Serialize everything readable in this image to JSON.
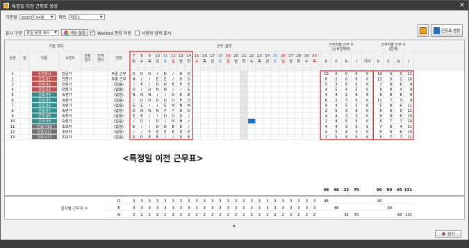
{
  "window": {
    "title": "특정일 이전 근무표 생성"
  },
  "filters": {
    "month_label": "기준월",
    "month_value": "2020년 04월",
    "part_label": "파트",
    "part_value": "파트1"
  },
  "display": {
    "label": "표시 구분",
    "value": "휴일 음영 표시",
    "color_btn": "색상 설정",
    "wanted_label": "Wanted 편집 허용",
    "user_input_label": "사용자 입력 표시"
  },
  "right_buttons": {
    "excel": "excel",
    "gen": "근무표 생성"
  },
  "headers": {
    "basic": "기본 정보",
    "shift": "근무 설정",
    "per_shift": "근무자별 근무 수",
    "per_shift_sub": "(공휴일제외)",
    "per_shift_total": "근무자별 근무 수",
    "per_shift_total_sub": "(합계)",
    "seq": "순번",
    "team": "팀",
    "name": "이름",
    "skill": "숙련도",
    "prev": "전월\n잔여",
    "carry": "잔여\n연차",
    "pattern": "전장",
    "etc": "기타"
  },
  "shift_cols": [
    "D",
    "E",
    "N",
    "/"
  ],
  "days": [
    {
      "d": "7",
      "w": "화"
    },
    {
      "d": "8",
      "w": "수"
    },
    {
      "d": "9",
      "w": "목"
    },
    {
      "d": "10",
      "w": "금"
    },
    {
      "d": "11",
      "w": "토"
    },
    {
      "d": "12",
      "w": "일"
    },
    {
      "d": "13",
      "w": "월"
    },
    {
      "d": "14",
      "w": "화"
    },
    {
      "d": "15",
      "w": "수"
    },
    {
      "d": "16",
      "w": "목"
    },
    {
      "d": "17",
      "w": "금"
    },
    {
      "d": "18",
      "w": "토"
    },
    {
      "d": "19",
      "w": "일"
    },
    {
      "d": "20",
      "w": "월"
    },
    {
      "d": "21",
      "w": "화"
    },
    {
      "d": "22",
      "w": "수"
    },
    {
      "d": "23",
      "w": "목"
    },
    {
      "d": "24",
      "w": "금"
    },
    {
      "d": "25",
      "w": "토"
    },
    {
      "d": "26",
      "w": "일"
    },
    {
      "d": "27",
      "w": "월"
    },
    {
      "d": "28",
      "w": "화"
    },
    {
      "d": "29",
      "w": "수"
    },
    {
      "d": "30",
      "w": "목"
    }
  ],
  "rows": [
    {
      "no": "1",
      "name": "수간호사",
      "skill": "전문가",
      "pat": "주중 근무",
      "badge": "red",
      "s": [
        "D",
        "D",
        "D",
        "/",
        "D",
        "/",
        "D",
        "D"
      ],
      "c1": [
        "10",
        "0",
        "0",
        "6"
      ],
      "etc": "0",
      "c2": [
        "19",
        "0",
        "0",
        "11"
      ]
    },
    {
      "no": "2",
      "name": "간호사1",
      "skill": "전문가",
      "pat": "주중 근무",
      "badge": "red",
      "s": [
        "N",
        "/",
        "/",
        "E",
        "E",
        "/",
        "D",
        "D"
      ],
      "c1": [
        "8",
        "2",
        "0",
        "6"
      ],
      "etc": "0",
      "c2": [
        "13",
        "5",
        "2",
        "10"
      ]
    },
    {
      "no": "3",
      "name": "간호사2",
      "skill": "전문가",
      "pat": "(없음)",
      "badge": "red",
      "s": [
        "/",
        "E",
        "/",
        "D",
        "D",
        "E",
        "E",
        "E"
      ],
      "c1": [
        "5",
        "3",
        "5",
        "5"
      ],
      "etc": "0",
      "c2": [
        "7",
        "8",
        "6",
        "9"
      ]
    },
    {
      "no": "4",
      "name": "간호사3",
      "skill": "전문가",
      "pat": "(없음)",
      "badge": "red",
      "s": [
        "D",
        "/",
        "D",
        "N",
        "N",
        "/",
        "/",
        "E"
      ],
      "c1": [
        "4",
        "5",
        "4",
        "5"
      ],
      "etc": "0",
      "c2": [
        "9",
        "8",
        "4",
        "9"
      ]
    },
    {
      "no": "5",
      "name": "간호사4",
      "skill": "숙련가",
      "pat": "(없음)",
      "badge": "teal",
      "s": [
        "N",
        "N",
        "N",
        "/",
        "/",
        "D",
        "E",
        "E"
      ],
      "c1": [
        "4",
        "4",
        "2",
        "6"
      ],
      "etc": "0",
      "c2": [
        "6",
        "8",
        "6",
        "8"
      ]
    },
    {
      "no": "6",
      "name": "간호사5",
      "skill": "숙련가",
      "pat": "(없음)",
      "badge": "teal",
      "s": [
        "/",
        "D",
        "D",
        "D",
        "D",
        "D",
        "E",
        "D"
      ],
      "c1": [
        "6",
        "2",
        "3",
        "5"
      ],
      "etc": "0",
      "c2": [
        "11",
        "7",
        "3",
        "9"
      ]
    },
    {
      "no": "7",
      "name": "간호사6",
      "skill": "숙련가",
      "pat": "(없음)",
      "badge": "teal",
      "s": [
        "E",
        "E",
        "/",
        "/",
        "E",
        "N",
        "N",
        "N"
      ],
      "c1": [
        "4",
        "4",
        "5",
        "5"
      ],
      "etc": "0",
      "c2": [
        "5",
        "8",
        "6",
        "11"
      ]
    },
    {
      "no": "8",
      "name": "간호사7",
      "skill": "숙련가",
      "pat": "(없음)",
      "badge": "teal",
      "s": [
        "D",
        "N",
        "N",
        "N",
        "/*",
        "/*",
        "D",
        "D"
      ],
      "c1": [
        "2",
        "5",
        "3",
        "6"
      ],
      "etc": "0",
      "c2": [
        "6",
        "6",
        "5",
        "11"
      ]
    },
    {
      "no": "9",
      "name": "간호사8",
      "skill": "숙련가",
      "pat": "(없음)",
      "badge": "teal",
      "s": [
        "E",
        "E",
        "/",
        "/",
        "D",
        "D",
        "D",
        "/"
      ],
      "c1": [
        "4",
        "4",
        "3",
        "5"
      ],
      "etc": "0",
      "c2": [
        "6",
        "8",
        "6",
        "10"
      ]
    },
    {
      "no": "10",
      "name": "간호사9",
      "skill": "숙련가",
      "pat": "(없음)",
      "badge": "teal",
      "s": [
        "/",
        "D",
        "/",
        "D",
        "/",
        "N",
        "N",
        "/"
      ],
      "c1": [
        "2",
        "4",
        "5",
        "5"
      ],
      "etc": "0",
      "c2": [
        "6",
        "7",
        "7",
        "10"
      ]
    },
    {
      "no": "11",
      "name": "간호사10",
      "skill": "초보자",
      "pat": "(없음)",
      "badge": "gray",
      "s": [
        "E",
        "/",
        "/",
        "D",
        "D",
        "E",
        "E",
        "/"
      ],
      "c1": [
        "4",
        "4",
        "3",
        "5"
      ],
      "etc": "0",
      "c2": [
        "7",
        "8",
        "4",
        "11"
      ]
    },
    {
      "no": "12",
      "name": "간호사11",
      "skill": "초보자",
      "pat": "(없음)",
      "badge": "gray",
      "s": [
        "/",
        "/",
        "E",
        "E",
        "E",
        "E",
        "D",
        "E"
      ],
      "c1": [
        "4",
        "5",
        "4",
        "5"
      ],
      "etc": "0",
      "c2": [
        "6",
        "6",
        "6",
        "10"
      ]
    },
    {
      "no": "13",
      "name": "간호사12",
      "skill": "초보자",
      "pat": "(없음)",
      "badge": "gray",
      "s": [
        "D",
        "D",
        "E",
        "E",
        "/",
        "/",
        "D",
        "E"
      ],
      "c1": [
        "2",
        "5",
        "4",
        "5"
      ],
      "etc": "0",
      "c2": [
        "5",
        "7",
        "7",
        "11"
      ]
    }
  ],
  "caption": "<특정일 이전 근무표>",
  "totals": {
    "c1": [
      "48",
      "48",
      "32",
      "70"
    ],
    "c2": [
      "90",
      "90",
      "60",
      "131"
    ]
  },
  "summary": {
    "label": "일자별 근무자 수",
    "rows": [
      {
        "k": "D",
        "v": [
          "3",
          "3",
          "3",
          "3",
          "3",
          "3",
          "3",
          "3",
          "3",
          "3",
          "3",
          "3",
          "3",
          "3",
          "3",
          "3",
          "3",
          "3",
          "3",
          "3",
          "3",
          "3",
          "3",
          "3"
        ],
        "t1": "48",
        "t2": "90"
      },
      {
        "k": "E",
        "v": [
          "3",
          "3",
          "3",
          "3",
          "3",
          "3",
          "3",
          "3",
          "3",
          "3",
          "3",
          "3",
          "3",
          "3",
          "3",
          "3",
          "3",
          "3",
          "3",
          "3",
          "3",
          "3",
          "3",
          "3"
        ],
        "t1": "48",
        "t2": "90"
      },
      {
        "k": "N",
        "v": [
          "2",
          "2",
          "2",
          "2",
          "2",
          "2",
          "2",
          "2",
          "2",
          "2",
          "2",
          "2",
          "2",
          "2",
          "2",
          "2",
          "2",
          "2",
          "2",
          "2",
          "2",
          "2",
          "2",
          "2"
        ],
        "t1": "32",
        "t2": "60",
        "t3": "70",
        "t4": "131"
      }
    ]
  },
  "footer": {
    "close": "닫기"
  }
}
